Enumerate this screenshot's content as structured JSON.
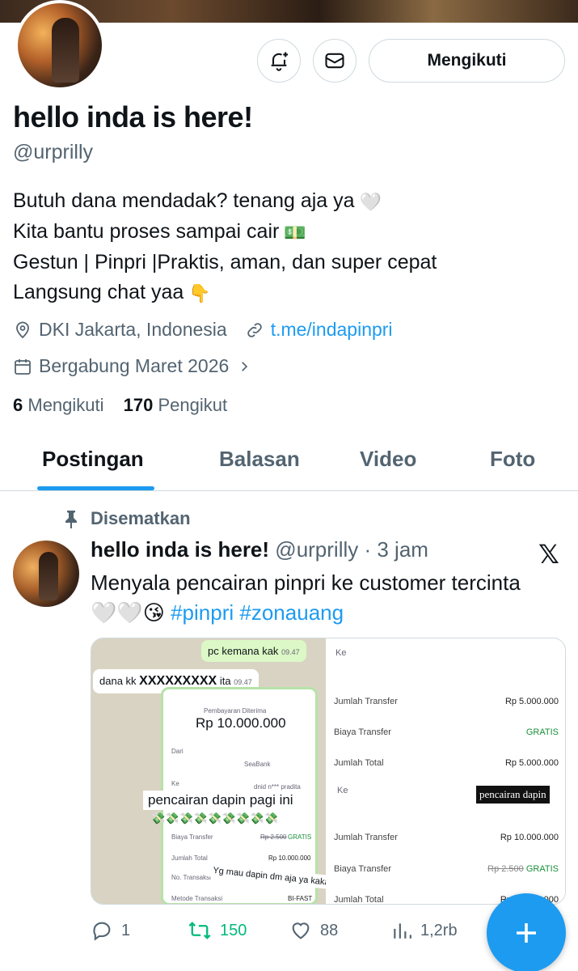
{
  "profile": {
    "name": "hello inda is here!",
    "handle": "@urprilly",
    "bio": [
      "Butuh dana mendadak? tenang aja ya",
      "Kita bantu proses sampai cair",
      "Gestun | Pinpri |Praktis, aman, dan super cepat",
      "Langsung chat yaa"
    ],
    "bio_emoji": [
      "🤍",
      "💵",
      "",
      "👇"
    ],
    "location": "DKI Jakarta, Indonesia",
    "website": "t.me/indapinpri",
    "joined": "Bergabung Maret 2026",
    "following_count": "6",
    "following_label": "Mengikuti",
    "followers_count": "170",
    "followers_label": "Pengikut",
    "follow_button": "Mengikuti"
  },
  "tabs": [
    "Postingan",
    "Balasan",
    "Video",
    "Foto"
  ],
  "post": {
    "pinned_label": "Disematkan",
    "author_name": "hello inda is here!",
    "author_handle": "@urprilly",
    "time": "3 jam",
    "text": "Menyala pencairan pinpri ke customer tercinta",
    "emoji": "🤍🤍😘",
    "hashtags": [
      "#pinpri",
      "#zonauang"
    ],
    "media": {
      "chat_out": "pc kemana kak",
      "chat_out_time": "09.47",
      "chat_in": "dana kk",
      "chat_in_mask": "XXXXXXXXX",
      "chat_in_tail": "ita",
      "chat_in_time": "09.47",
      "receipt_title": "Pembayaran Diterima",
      "receipt_amount": "Rp 10.000.000",
      "from_label": "Dari",
      "bank": "SeaBank",
      "to_label": "Ke",
      "to_name": "dnid n*** pradita",
      "caption1": "pencairan dapin pagi ini",
      "caption_emoji": "💸💸💸💸💸💸💸💸💸",
      "fee_label": "Biaya Transfer",
      "fee_struck": "Rp 2.500",
      "fee_free": "GRATIS",
      "total_label": "Jumlah Total",
      "total_value": "Rp 10.000.000",
      "txn_label": "No. Transaksi",
      "method_label": "Metode Transaksi",
      "method_value": "BI-FAST",
      "caption2": "Yg mau dapin dm aja ya kaka🤑",
      "right_ke": "Ke",
      "r_transfer_label": "Jumlah Transfer",
      "r_transfer_value": "Rp 5.000.000",
      "r_fee_label": "Biaya Transfer",
      "r_fee_value": "GRATIS",
      "r_total_label": "Jumlah Total",
      "r_total_value": "Rp 5.000.000",
      "r_ke2": "Ke",
      "r_caption": "pencairan dapin",
      "r_transfer2_label": "Jumlah Transfer",
      "r_transfer2_value": "Rp 10.000.000",
      "r_fee2_label": "Biaya Transfer",
      "r_fee2_struck": "Rp 2.500",
      "r_fee2_free": "GRATIS",
      "r_total2_label": "Jumlah Total",
      "r_total2_value": "Rp 10.000.000"
    },
    "replies": "1",
    "reposts": "150",
    "likes": "88",
    "views": "1,2rb"
  },
  "colors": {
    "accent": "#1d9bf0",
    "muted": "#536471",
    "repost": "#00ba7c"
  }
}
